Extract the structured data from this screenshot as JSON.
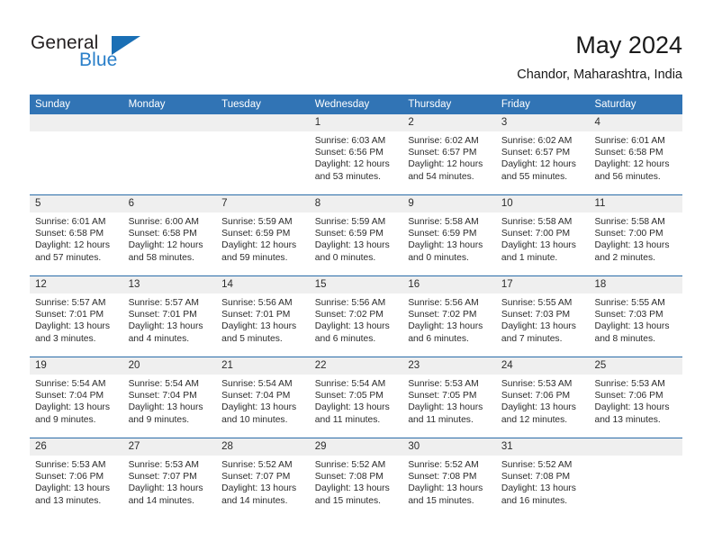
{
  "brand": {
    "word_one": "General",
    "word_two": "Blue",
    "accent_color": "#2a7fc9",
    "triangle_color": "#1a6fb5"
  },
  "header": {
    "title": "May 2024",
    "location": "Chandor, Maharashtra, India"
  },
  "theme": {
    "header_blue": "#3174b5",
    "row_rule_blue": "#2a6ca8",
    "day_band_gray": "#efefef"
  },
  "weekdays": [
    "Sunday",
    "Monday",
    "Tuesday",
    "Wednesday",
    "Thursday",
    "Friday",
    "Saturday"
  ],
  "weeks": [
    [
      {
        "day": "",
        "lines": []
      },
      {
        "day": "",
        "lines": []
      },
      {
        "day": "",
        "lines": []
      },
      {
        "day": "1",
        "lines": [
          "Sunrise: 6:03 AM",
          "Sunset: 6:56 PM",
          "Daylight: 12 hours",
          "and 53 minutes."
        ]
      },
      {
        "day": "2",
        "lines": [
          "Sunrise: 6:02 AM",
          "Sunset: 6:57 PM",
          "Daylight: 12 hours",
          "and 54 minutes."
        ]
      },
      {
        "day": "3",
        "lines": [
          "Sunrise: 6:02 AM",
          "Sunset: 6:57 PM",
          "Daylight: 12 hours",
          "and 55 minutes."
        ]
      },
      {
        "day": "4",
        "lines": [
          "Sunrise: 6:01 AM",
          "Sunset: 6:58 PM",
          "Daylight: 12 hours",
          "and 56 minutes."
        ]
      }
    ],
    [
      {
        "day": "5",
        "lines": [
          "Sunrise: 6:01 AM",
          "Sunset: 6:58 PM",
          "Daylight: 12 hours",
          "and 57 minutes."
        ]
      },
      {
        "day": "6",
        "lines": [
          "Sunrise: 6:00 AM",
          "Sunset: 6:58 PM",
          "Daylight: 12 hours",
          "and 58 minutes."
        ]
      },
      {
        "day": "7",
        "lines": [
          "Sunrise: 5:59 AM",
          "Sunset: 6:59 PM",
          "Daylight: 12 hours",
          "and 59 minutes."
        ]
      },
      {
        "day": "8",
        "lines": [
          "Sunrise: 5:59 AM",
          "Sunset: 6:59 PM",
          "Daylight: 13 hours",
          "and 0 minutes."
        ]
      },
      {
        "day": "9",
        "lines": [
          "Sunrise: 5:58 AM",
          "Sunset: 6:59 PM",
          "Daylight: 13 hours",
          "and 0 minutes."
        ]
      },
      {
        "day": "10",
        "lines": [
          "Sunrise: 5:58 AM",
          "Sunset: 7:00 PM",
          "Daylight: 13 hours",
          "and 1 minute."
        ]
      },
      {
        "day": "11",
        "lines": [
          "Sunrise: 5:58 AM",
          "Sunset: 7:00 PM",
          "Daylight: 13 hours",
          "and 2 minutes."
        ]
      }
    ],
    [
      {
        "day": "12",
        "lines": [
          "Sunrise: 5:57 AM",
          "Sunset: 7:01 PM",
          "Daylight: 13 hours",
          "and 3 minutes."
        ]
      },
      {
        "day": "13",
        "lines": [
          "Sunrise: 5:57 AM",
          "Sunset: 7:01 PM",
          "Daylight: 13 hours",
          "and 4 minutes."
        ]
      },
      {
        "day": "14",
        "lines": [
          "Sunrise: 5:56 AM",
          "Sunset: 7:01 PM",
          "Daylight: 13 hours",
          "and 5 minutes."
        ]
      },
      {
        "day": "15",
        "lines": [
          "Sunrise: 5:56 AM",
          "Sunset: 7:02 PM",
          "Daylight: 13 hours",
          "and 6 minutes."
        ]
      },
      {
        "day": "16",
        "lines": [
          "Sunrise: 5:56 AM",
          "Sunset: 7:02 PM",
          "Daylight: 13 hours",
          "and 6 minutes."
        ]
      },
      {
        "day": "17",
        "lines": [
          "Sunrise: 5:55 AM",
          "Sunset: 7:03 PM",
          "Daylight: 13 hours",
          "and 7 minutes."
        ]
      },
      {
        "day": "18",
        "lines": [
          "Sunrise: 5:55 AM",
          "Sunset: 7:03 PM",
          "Daylight: 13 hours",
          "and 8 minutes."
        ]
      }
    ],
    [
      {
        "day": "19",
        "lines": [
          "Sunrise: 5:54 AM",
          "Sunset: 7:04 PM",
          "Daylight: 13 hours",
          "and 9 minutes."
        ]
      },
      {
        "day": "20",
        "lines": [
          "Sunrise: 5:54 AM",
          "Sunset: 7:04 PM",
          "Daylight: 13 hours",
          "and 9 minutes."
        ]
      },
      {
        "day": "21",
        "lines": [
          "Sunrise: 5:54 AM",
          "Sunset: 7:04 PM",
          "Daylight: 13 hours",
          "and 10 minutes."
        ]
      },
      {
        "day": "22",
        "lines": [
          "Sunrise: 5:54 AM",
          "Sunset: 7:05 PM",
          "Daylight: 13 hours",
          "and 11 minutes."
        ]
      },
      {
        "day": "23",
        "lines": [
          "Sunrise: 5:53 AM",
          "Sunset: 7:05 PM",
          "Daylight: 13 hours",
          "and 11 minutes."
        ]
      },
      {
        "day": "24",
        "lines": [
          "Sunrise: 5:53 AM",
          "Sunset: 7:06 PM",
          "Daylight: 13 hours",
          "and 12 minutes."
        ]
      },
      {
        "day": "25",
        "lines": [
          "Sunrise: 5:53 AM",
          "Sunset: 7:06 PM",
          "Daylight: 13 hours",
          "and 13 minutes."
        ]
      }
    ],
    [
      {
        "day": "26",
        "lines": [
          "Sunrise: 5:53 AM",
          "Sunset: 7:06 PM",
          "Daylight: 13 hours",
          "and 13 minutes."
        ]
      },
      {
        "day": "27",
        "lines": [
          "Sunrise: 5:53 AM",
          "Sunset: 7:07 PM",
          "Daylight: 13 hours",
          "and 14 minutes."
        ]
      },
      {
        "day": "28",
        "lines": [
          "Sunrise: 5:52 AM",
          "Sunset: 7:07 PM",
          "Daylight: 13 hours",
          "and 14 minutes."
        ]
      },
      {
        "day": "29",
        "lines": [
          "Sunrise: 5:52 AM",
          "Sunset: 7:08 PM",
          "Daylight: 13 hours",
          "and 15 minutes."
        ]
      },
      {
        "day": "30",
        "lines": [
          "Sunrise: 5:52 AM",
          "Sunset: 7:08 PM",
          "Daylight: 13 hours",
          "and 15 minutes."
        ]
      },
      {
        "day": "31",
        "lines": [
          "Sunrise: 5:52 AM",
          "Sunset: 7:08 PM",
          "Daylight: 13 hours",
          "and 16 minutes."
        ]
      },
      {
        "day": "",
        "lines": []
      }
    ]
  ]
}
